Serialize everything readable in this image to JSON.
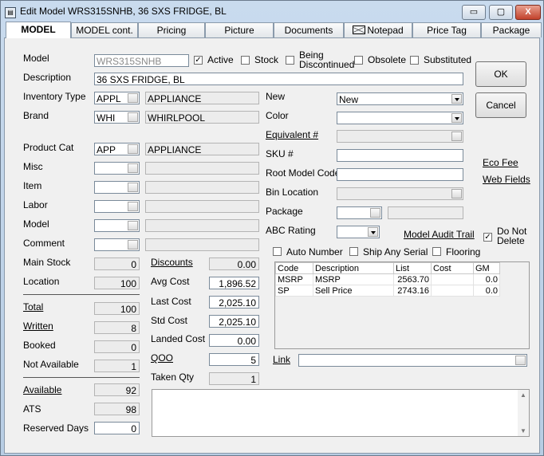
{
  "window": {
    "title": "Edit Model WRS315SNHB, 36 SXS FRIDGE, BL",
    "minimize": "▭",
    "maximize": "▢",
    "close": "X"
  },
  "tabs": [
    "MODEL",
    "MODEL cont.",
    "Pricing",
    "Picture",
    "Documents",
    "Notepad",
    "Price Tag",
    "Package"
  ],
  "header": {
    "model_label": "Model",
    "model_value": "WRS315SNHB",
    "active_label": "Active",
    "stock_label": "Stock",
    "discontinued_label_1": "Being",
    "discontinued_label_2": "Discontinued",
    "obsolete_label": "Obsolete",
    "substituted_label": "Substituted",
    "description_label": "Description",
    "description_value": "36 SXS FRIDGE, BL"
  },
  "left": {
    "inventory_type_label": "Inventory Type",
    "inventory_type_code": "APPL",
    "inventory_type_name": "APPLIANCE",
    "brand_label": "Brand",
    "brand_code": "WHI",
    "brand_name": "WHIRLPOOL",
    "product_cat_label": "Product Cat",
    "product_cat_code": "APP",
    "product_cat_name": "APPLIANCE",
    "misc_label": "Misc",
    "item_label": "Item",
    "labor_label": "Labor",
    "model_label": "Model",
    "comment_label": "Comment"
  },
  "stock": {
    "main_stock_label": "Main Stock",
    "main_stock": "0",
    "location_label": "Location",
    "location": "100",
    "total_label": "Total",
    "total": "100",
    "written_label": "Written",
    "written": "8",
    "booked_label": "Booked",
    "booked": "0",
    "not_available_label": "Not Available",
    "not_available": "1",
    "available_label": "Available",
    "available": "92",
    "ats_label": "ATS",
    "ats": "98",
    "reserved_days_label": "Reserved Days",
    "reserved_days": "0"
  },
  "costs": {
    "discounts_label": "Discounts",
    "discounts": "0.00",
    "avg_cost_label": "Avg Cost",
    "avg_cost": "1,896.52",
    "last_cost_label": "Last Cost",
    "last_cost": "2,025.10",
    "std_cost_label": "Std Cost",
    "std_cost": "2,025.10",
    "landed_cost_label": "Landed Cost",
    "landed_cost": "0.00",
    "qoo_label": "QOO",
    "qoo": "5",
    "taken_qty_label": "Taken Qty",
    "taken_qty": "1"
  },
  "right": {
    "new_label": "New",
    "new_value": "New",
    "color_label": "Color",
    "equivalent_label": "Equivalent #",
    "sku_label": "SKU #",
    "root_model_label": "Root Model Code",
    "bin_location_label": "Bin Location",
    "package_label": "Package",
    "abc_rating_label": "ABC Rating",
    "model_audit_trail": "Model Audit Trail",
    "do_not_delete_1": "Do Not",
    "do_not_delete_2": "Delete",
    "auto_number_label": "Auto Number",
    "ship_any_serial_label": "Ship Any Serial",
    "flooring_label": "Flooring",
    "link_label": "Link"
  },
  "buttons": {
    "ok": "OK",
    "cancel": "Cancel",
    "eco_fee": "Eco Fee",
    "web_fields": "Web Fields"
  },
  "price_grid": {
    "columns": [
      "Code",
      "Description",
      "List",
      "Cost",
      "GM"
    ],
    "rows": [
      {
        "code": "MSRP",
        "description": "MSRP",
        "list": "2563.70",
        "cost": "",
        "gm": "0.0"
      },
      {
        "code": "SP",
        "description": "Sell Price",
        "list": "2743.16",
        "cost": "",
        "gm": "0.0"
      }
    ]
  },
  "icons": {
    "notepad": "envelope-icon",
    "scroll_up": "▲",
    "scroll_down": "▼"
  }
}
